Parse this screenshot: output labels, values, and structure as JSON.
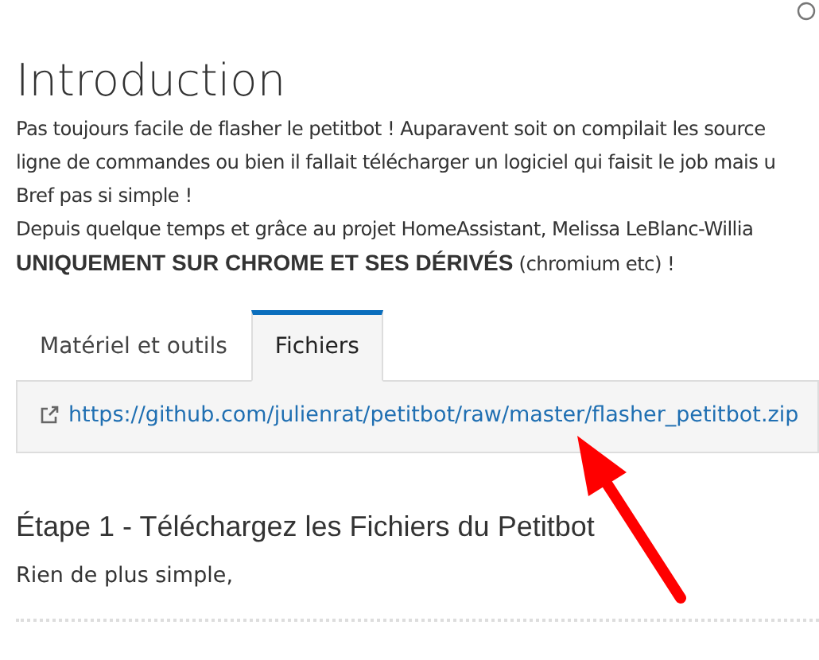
{
  "title": "Introduction",
  "intro_lines": [
    "Pas toujours facile de flasher le petitbot ! Auparavent soit on compilait les source",
    "ligne de commandes ou bien il fallait télécharger un logiciel qui faisit le job mais u",
    "Bref pas si simple !",
    "Depuis quelque temps et grâce au projet HomeAssistant, Melissa LeBlanc-Willia",
    "**UNIQUEMENT SUR CHROME ET SES DÉRIVÉS** (chromium etc) !"
  ],
  "tabs": [
    {
      "label": "Matériel et outils",
      "selected": false
    },
    {
      "label": "Fichiers",
      "selected": true
    }
  ],
  "files": [
    {
      "url": "https://github.com/julienrat/petitbot/raw/master/flasher_petitbot.zip"
    }
  ],
  "step": {
    "title": "Étape 1 - Téléchargez les Fichiers du Petitbot",
    "text": "Rien de plus simple,"
  }
}
